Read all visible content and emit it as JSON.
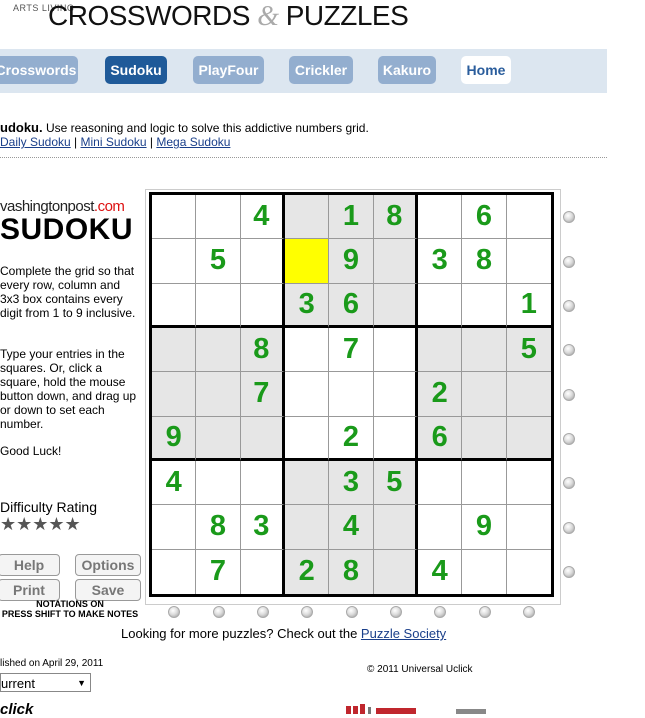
{
  "header": {
    "brand_small": "ARTS LIVING",
    "brand_main_1": "CROSSWORDS",
    "brand_amp": "&",
    "brand_main_2": "PUZZLES"
  },
  "nav": {
    "tabs": [
      "Crosswords",
      "Sudoku",
      "PlayFour",
      "Crickler",
      "Kakuro",
      "Home"
    ],
    "active": "Sudoku"
  },
  "intro": {
    "title": "udoku.",
    "text": " Use reasoning and logic to solve this addictive numbers grid.",
    "links": [
      "Daily Sudoku",
      "Mini Sudoku",
      "Mega Sudoku"
    ],
    "separator": " | "
  },
  "panel": {
    "source_name": "vashingtonpost",
    "source_tld": ".com",
    "title": "SUDOKU",
    "instructions_1": "Complete the grid so that every row, column and 3x3 box contains every digit from 1 to 9 inclusive.",
    "instructions_2": "Type your entries in the squares. Or, click a square, hold the mouse button down, and drag up or down to set each number.",
    "good_luck": "Good Luck!",
    "difficulty_label": "Difficulty Rating",
    "difficulty_stars": "★★★★★",
    "difficulty_value": 5,
    "buttons": {
      "help": "Help",
      "options": "Options",
      "print": "Print",
      "save": "Save"
    },
    "notations_1": "NOTATIONS ON",
    "notations_2": "PRESS SHIFT TO MAKE NOTES"
  },
  "grid": {
    "rows": [
      [
        "",
        "",
        "4",
        "",
        "1",
        "8",
        "",
        "6",
        ""
      ],
      [
        "",
        "5",
        "",
        "",
        "9",
        "",
        "3",
        "8",
        ""
      ],
      [
        "",
        "",
        "",
        "3",
        "6",
        "",
        "",
        "",
        "1"
      ],
      [
        "",
        "",
        "8",
        "",
        "7",
        "",
        "",
        "",
        "5"
      ],
      [
        "",
        "",
        "7",
        "",
        "",
        "",
        "2",
        "",
        ""
      ],
      [
        "9",
        "",
        "",
        "",
        "2",
        "",
        "6",
        "",
        ""
      ],
      [
        "4",
        "",
        "",
        "",
        "3",
        "5",
        "",
        "",
        ""
      ],
      [
        "",
        "8",
        "3",
        "",
        "4",
        "",
        "",
        "9",
        ""
      ],
      [
        "",
        "7",
        "",
        "2",
        "8",
        "",
        "4",
        "",
        ""
      ]
    ],
    "selected_row": 1,
    "selected_col": 3,
    "digit_color": "#1a9a1a",
    "selected_color": "#ffff00"
  },
  "footer": {
    "more_text": "Looking for more puzzles? Check out the ",
    "more_link": "Puzzle Society",
    "published": "lished on April 29, 2011",
    "copyright": "© 2011 Universal Uclick",
    "select_value": "urrent",
    "uclick_logo": "click"
  }
}
